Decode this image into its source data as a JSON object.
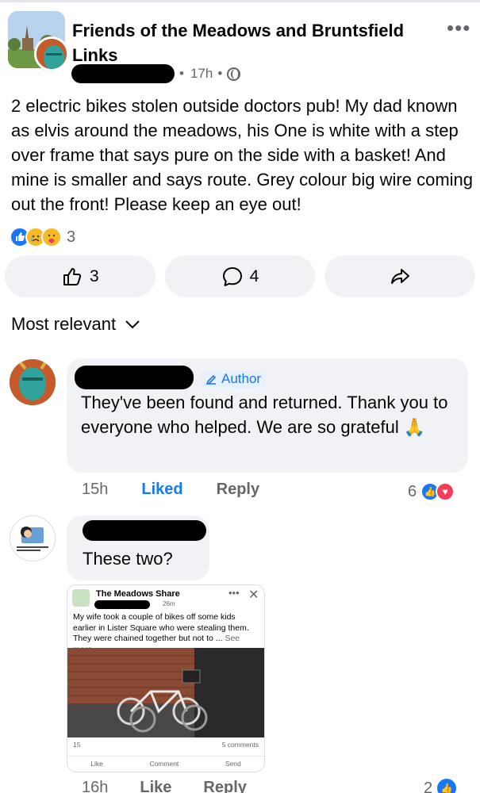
{
  "post": {
    "group_name": "Friends of the Meadows and Bruntsfield Links",
    "time": "17h",
    "visibility_icon": "globe-icon",
    "text": "2 electric bikes stolen outside doctors pub!  My dad known as elvis around the meadows,  his One is white with a step over frame that says pure on the side with a basket! And mine is smaller and says route. Grey colour big wire coming out the front! Please keep an eye out!",
    "reaction_count": "3",
    "actions": {
      "like_count": "3",
      "comment_count": "4"
    }
  },
  "sort": {
    "label": "Most relevant"
  },
  "comments": [
    {
      "badge": "Author",
      "text": "They've been found and returned. Thank you to everyone who helped. We are so grateful 🙏",
      "time": "15h",
      "like_label": "Liked",
      "reply_label": "Reply",
      "reaction_count": "6"
    },
    {
      "text": "These two?",
      "time": "16h",
      "like_label": "Like",
      "reply_label": "Reply",
      "reaction_count": "2",
      "shared": {
        "page_name": "The Meadows Share",
        "time": "26m",
        "text": "My wife took a couple of bikes off some kids earlier in Lister Square who were stealing them. They were chained together but not to ...",
        "see_more": "See more",
        "reactions": "15",
        "comments": "5 comments",
        "like": "Like",
        "comment": "Comment",
        "send": "Send"
      }
    }
  ],
  "colors": {
    "accent": "#1877f2",
    "muted": "#65676b",
    "bubble": "#f0f2f5"
  }
}
